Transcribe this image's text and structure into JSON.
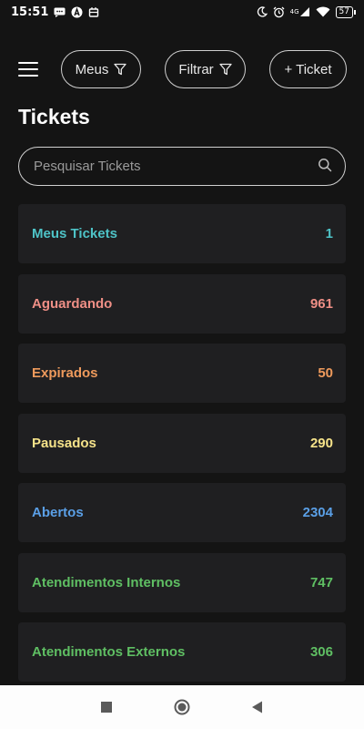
{
  "status_bar": {
    "time": "15:51",
    "battery": "57",
    "network": "4G"
  },
  "header": {
    "meus_label": "Meus",
    "filtrar_label": "Filtrar",
    "add_ticket_label": "+ Ticket"
  },
  "page": {
    "title": "Tickets"
  },
  "search": {
    "placeholder": "Pesquisar Tickets",
    "value": ""
  },
  "categories": [
    {
      "label": "Meus Tickets",
      "count": "1",
      "color": "#4ec3c7"
    },
    {
      "label": "Aguardando",
      "count": "961",
      "color": "#ef8f86"
    },
    {
      "label": "Expirados",
      "count": "50",
      "color": "#ee9a5c"
    },
    {
      "label": "Pausados",
      "count": "290",
      "color": "#f6e38a"
    },
    {
      "label": "Abertos",
      "count": "2304",
      "color": "#5a9fe6"
    },
    {
      "label": "Atendimentos Internos",
      "count": "747",
      "color": "#5fbf63"
    },
    {
      "label": "Atendimentos Externos",
      "count": "306",
      "color": "#5fbf63"
    }
  ],
  "icons": {
    "menu": "hamburger-icon",
    "filter": "filter-funnel-icon",
    "search": "search-icon",
    "nav_recents": "square-icon",
    "nav_home": "circle-icon",
    "nav_back": "triangle-back-icon"
  }
}
